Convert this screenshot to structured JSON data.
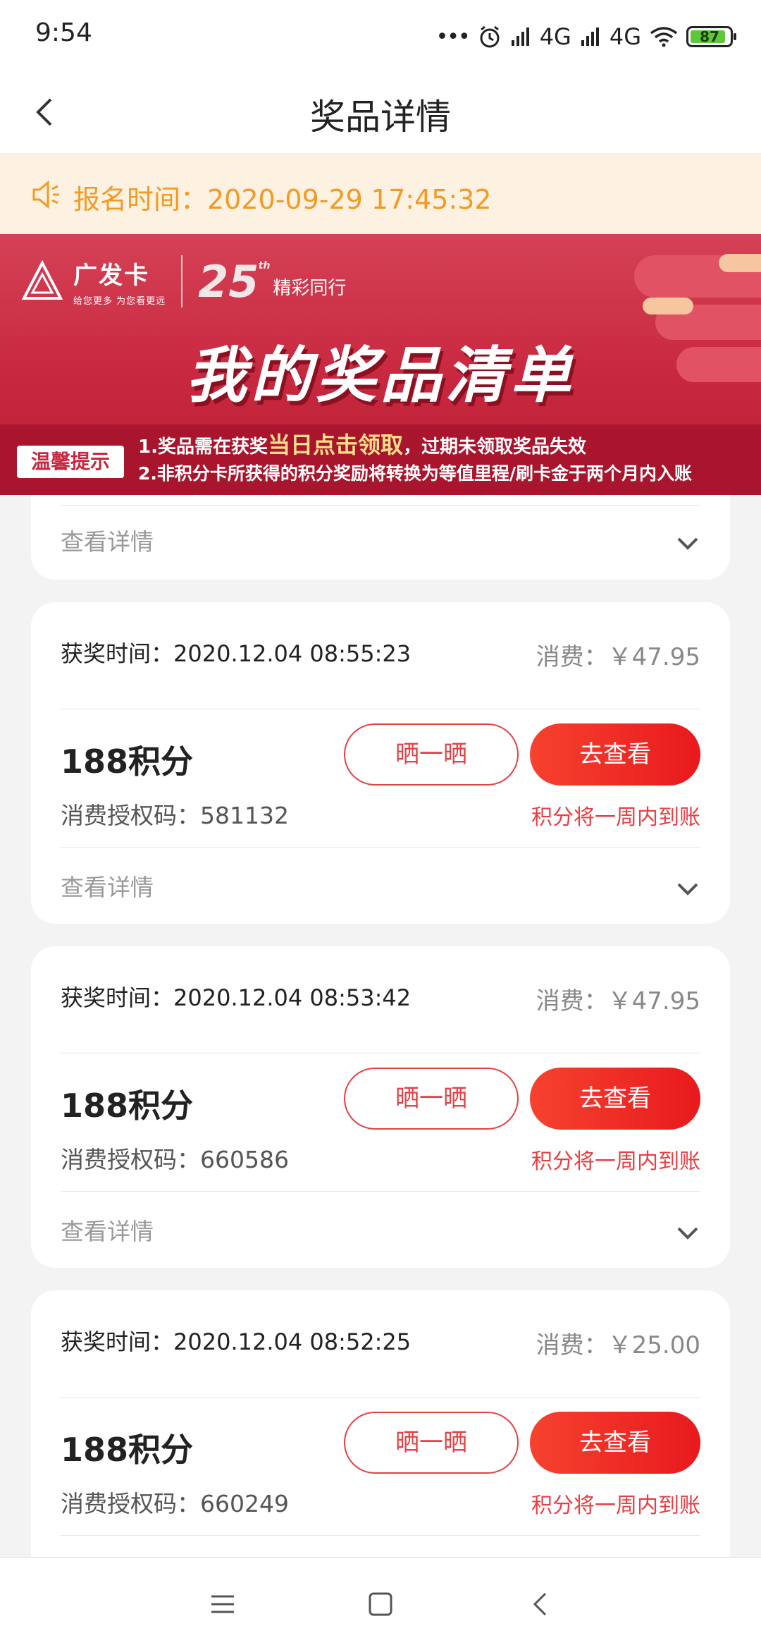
{
  "status_bar": {
    "time": "9:54",
    "network_1": "4G",
    "network_2": "4G",
    "battery": "87"
  },
  "header": {
    "title": "奖品详情"
  },
  "notice": {
    "text": "报名时间：2020-09-29 17:45:32"
  },
  "banner": {
    "logo_main": "广发卡",
    "logo_sub": "给您更多 为您看更远",
    "anniversary": "25",
    "anniversary_suffix": "th",
    "anniversary_text": "精彩同行",
    "title": "我的奖品清单",
    "tips_badge": "温馨提示",
    "tip_line_1_prefix": "1.奖品需在获奖",
    "tip_line_1_highlight": "当日点击领取",
    "tip_line_1_suffix": "，过期未领取奖品失效",
    "tip_line_2": "2.非积分卡所获得的积分奖励将转换为等值里程/刷卡金于两个月内入账"
  },
  "partial_card": {
    "detail_label": "查看详情"
  },
  "cards": [
    {
      "award_time": "获奖时间：2020.12.04 08:55:23",
      "spend": "消费：￥47.95",
      "points": "188积分",
      "auth_code": "消费授权码：581132",
      "share_label": "晒一晒",
      "view_label": "去查看",
      "arrive_note": "积分将一周内到账",
      "detail_label": "查看详情"
    },
    {
      "award_time": "获奖时间：2020.12.04 08:53:42",
      "spend": "消费：￥47.95",
      "points": "188积分",
      "auth_code": "消费授权码：660586",
      "share_label": "晒一晒",
      "view_label": "去查看",
      "arrive_note": "积分将一周内到账",
      "detail_label": "查看详情"
    },
    {
      "award_time": "获奖时间：2020.12.04 08:52:25",
      "spend": "消费：￥25.00",
      "points": "188积分",
      "auth_code": "消费授权码：660249",
      "share_label": "晒一晒",
      "view_label": "去查看",
      "arrive_note": "积分将一周内到账"
    }
  ],
  "colors": {
    "accent_red": "#e64044",
    "notice_orange": "#f39a23",
    "banner_red": "#c8283f"
  }
}
